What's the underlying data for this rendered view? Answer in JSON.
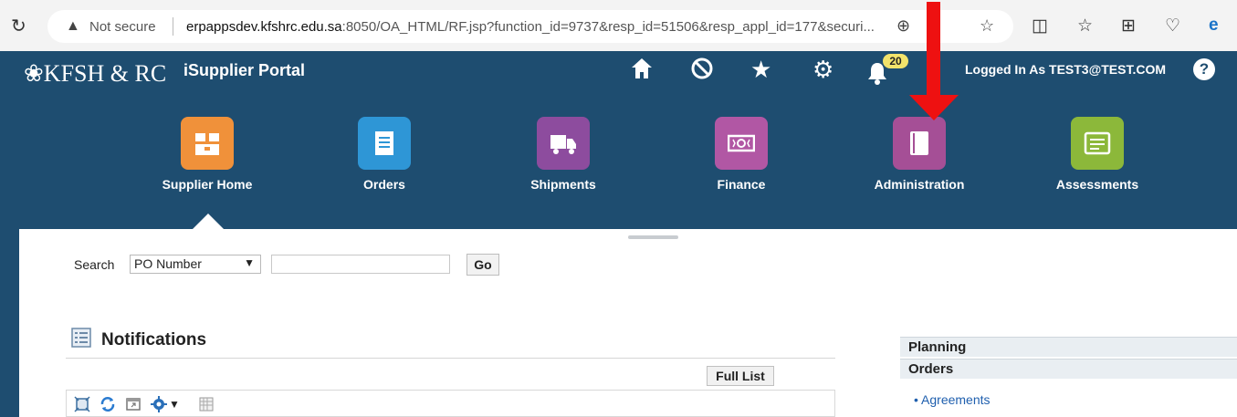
{
  "browser": {
    "security_label": "Not secure",
    "url_host": "erpappsdev.kfshrc.edu.sa",
    "url_rest": ":8050/OA_HTML/RF.jsp?function_id=9737&resp_id=51506&resp_appl_id=177&securi..."
  },
  "header": {
    "logo_text": "KFSH & RC",
    "portal_title": "iSupplier Portal",
    "notification_count": "20",
    "logged_in_text": "Logged In As TEST3@TEST.COM",
    "help_label": "?",
    "bg_color": "#1e4d70"
  },
  "nav": {
    "items": [
      {
        "label": "Supplier Home",
        "icon": "warehouse-icon",
        "color": "#f0913a"
      },
      {
        "label": "Orders",
        "icon": "document-icon",
        "color": "#2e96d6"
      },
      {
        "label": "Shipments",
        "icon": "truck-icon",
        "color": "#8d4c9e"
      },
      {
        "label": "Finance",
        "icon": "money-icon",
        "color": "#b157a4"
      },
      {
        "label": "Administration",
        "icon": "binder-icon",
        "color": "#a54f96"
      },
      {
        "label": "Assessments",
        "icon": "form-icon",
        "color": "#8cb83a"
      }
    ]
  },
  "search": {
    "label": "Search",
    "selected_option": "PO Number",
    "query_value": "",
    "go_label": "Go"
  },
  "notifications": {
    "title": "Notifications",
    "full_list_label": "Full List"
  },
  "side_panel": {
    "sections": [
      "Planning",
      "Orders"
    ],
    "links": [
      "Agreements"
    ]
  },
  "annotation": {
    "arrow_color": "#ee1111"
  }
}
